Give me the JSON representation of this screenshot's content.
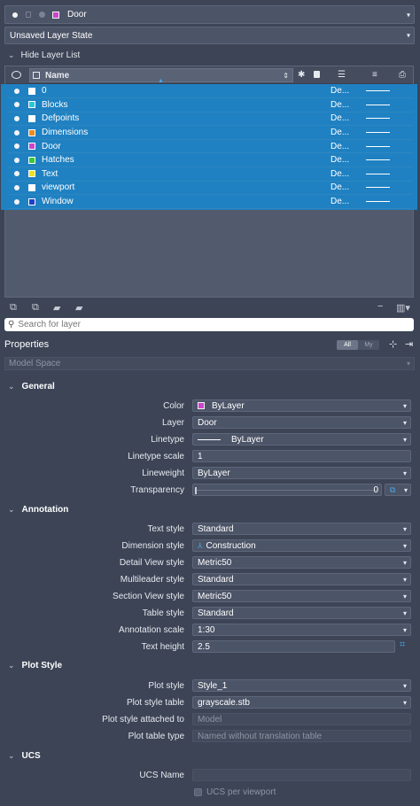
{
  "current_layer": {
    "name": "Door",
    "color": "#cc44cc"
  },
  "layer_state": "Unsaved Layer State",
  "layer_list_toggle": "Hide Layer List",
  "layer_table": {
    "header_name": "Name",
    "rows": [
      {
        "name": "0",
        "color": "#ffffff",
        "desc": "De..."
      },
      {
        "name": "Blocks",
        "color": "#28c8d8",
        "desc": "De..."
      },
      {
        "name": "Defpoints",
        "color": "#ffffff",
        "desc": "De..."
      },
      {
        "name": "Dimensions",
        "color": "#f08a1e",
        "desc": "De..."
      },
      {
        "name": "Door",
        "color": "#cc44cc",
        "desc": "De..."
      },
      {
        "name": "Hatches",
        "color": "#38c838",
        "desc": "De..."
      },
      {
        "name": "Text",
        "color": "#f0e020",
        "desc": "De..."
      },
      {
        "name": "viewport",
        "color": "#ffffff",
        "desc": "De..."
      },
      {
        "name": "Window",
        "color": "#1e3fc8",
        "desc": "De..."
      }
    ]
  },
  "search": {
    "placeholder": "Search for layer"
  },
  "properties": {
    "title": "Properties",
    "filter_all": "All",
    "filter_my": "My",
    "space": "Model Space",
    "general": {
      "header": "General",
      "color_label": "Color",
      "color_value": "ByLayer",
      "layer_label": "Layer",
      "layer_value": "Door",
      "linetype_label": "Linetype",
      "linetype_value": "ByLayer",
      "linetype_scale_label": "Linetype scale",
      "linetype_scale_value": "1",
      "lineweight_label": "Lineweight",
      "lineweight_value": "ByLayer",
      "transparency_label": "Transparency",
      "transparency_value": "0"
    },
    "annotation": {
      "header": "Annotation",
      "text_style_label": "Text style",
      "text_style_value": "Standard",
      "dimension_style_label": "Dimension style",
      "dimension_style_value": "Construction",
      "detail_view_label": "Detail View style",
      "detail_view_value": "Metric50",
      "multileader_label": "Multileader style",
      "multileader_value": "Standard",
      "section_view_label": "Section View style",
      "section_view_value": "Metric50",
      "table_style_label": "Table style",
      "table_style_value": "Standard",
      "annotation_scale_label": "Annotation scale",
      "annotation_scale_value": "1:30",
      "text_height_label": "Text height",
      "text_height_value": "2.5"
    },
    "plot_style": {
      "header": "Plot Style",
      "plot_style_label": "Plot style",
      "plot_style_value": "Style_1",
      "plot_style_table_label": "Plot style table",
      "plot_style_table_value": "grayscale.stb",
      "attached_label": "Plot style attached to",
      "attached_value": "Model",
      "table_type_label": "Plot table type",
      "table_type_value": "Named without translation table"
    },
    "ucs": {
      "header": "UCS",
      "ucs_name_label": "UCS Name",
      "ucs_name_value": "",
      "ucs_per_viewport_label": "UCS per viewport"
    }
  }
}
